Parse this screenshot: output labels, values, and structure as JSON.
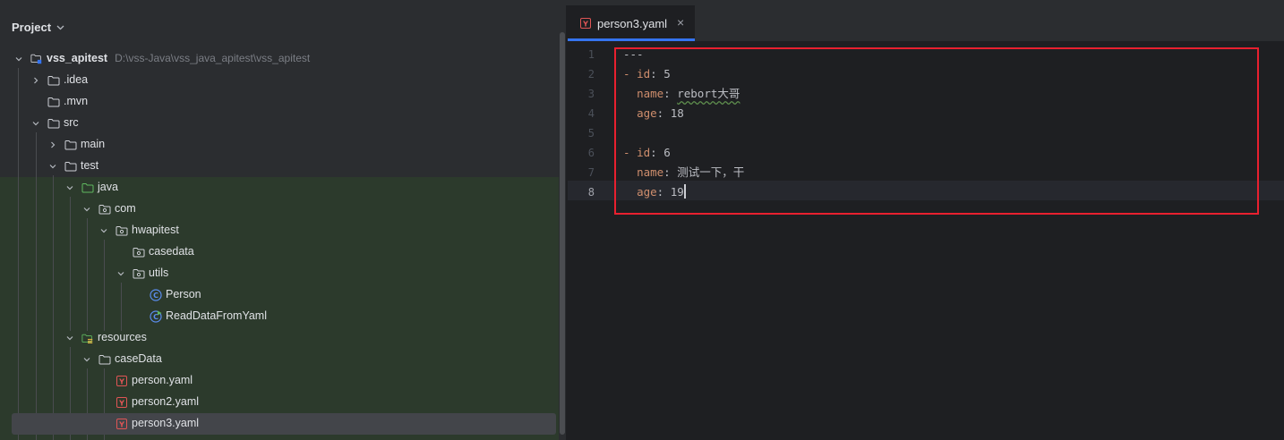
{
  "project": {
    "title": "Project",
    "tree": [
      {
        "label": "vss_apitest",
        "path": "D:\\vss-Java\\vss_java_apitest\\vss_apitest",
        "icon": "module-folder-icon",
        "expanded": true,
        "depth": 0
      },
      {
        "label": ".idea",
        "icon": "folder-icon",
        "expanded": false,
        "depth": 1
      },
      {
        "label": ".mvn",
        "icon": "folder-icon",
        "depth": 1
      },
      {
        "label": "src",
        "icon": "folder-icon",
        "expanded": true,
        "depth": 1
      },
      {
        "label": "main",
        "icon": "folder-icon",
        "expanded": false,
        "depth": 2
      },
      {
        "label": "test",
        "icon": "folder-icon",
        "expanded": true,
        "depth": 2
      },
      {
        "label": "java",
        "icon": "test-source-folder-icon",
        "expanded": true,
        "depth": 3
      },
      {
        "label": "com",
        "icon": "package-icon",
        "expanded": true,
        "depth": 4
      },
      {
        "label": "hwapitest",
        "icon": "package-icon",
        "expanded": true,
        "depth": 5
      },
      {
        "label": "casedata",
        "icon": "package-icon",
        "depth": 6
      },
      {
        "label": "utils",
        "icon": "package-icon",
        "expanded": true,
        "depth": 6
      },
      {
        "label": "Person",
        "icon": "java-class-icon",
        "depth": 7
      },
      {
        "label": "ReadDataFromYaml",
        "icon": "java-class-runnable-icon",
        "depth": 7
      },
      {
        "label": "resources",
        "icon": "test-resources-folder-icon",
        "expanded": true,
        "depth": 3
      },
      {
        "label": "caseData",
        "icon": "folder-icon",
        "expanded": true,
        "depth": 4
      },
      {
        "label": "person.yaml",
        "icon": "yaml-file-icon",
        "depth": 5
      },
      {
        "label": "person2.yaml",
        "icon": "yaml-file-icon",
        "depth": 5
      },
      {
        "label": "person3.yaml",
        "icon": "yaml-file-icon",
        "depth": 5,
        "selected": true
      }
    ]
  },
  "editor": {
    "tab": {
      "label": "person3.yaml",
      "close": "×"
    },
    "line_numbers": [
      "1",
      "2",
      "3",
      "4",
      "5",
      "6",
      "7",
      "8"
    ],
    "current_line": 8,
    "lines": [
      {
        "text": "---"
      },
      {
        "dash": "- ",
        "key": "id",
        "sep": ": ",
        "value": "5"
      },
      {
        "indent": "  ",
        "key": "name",
        "sep": ": ",
        "value": "rebort大哥"
      },
      {
        "indent": "  ",
        "key": "age",
        "sep": ": ",
        "value": "18"
      },
      {
        "text": ""
      },
      {
        "dash": "- ",
        "key": "id",
        "sep": ": ",
        "value": "6"
      },
      {
        "indent": "  ",
        "key": "name",
        "sep": ": ",
        "value": "测试一下，干"
      },
      {
        "indent": "  ",
        "key": "age",
        "sep": ": ",
        "value": "19"
      }
    ]
  },
  "colors": {
    "accent": "#3574f0",
    "highlight_box": "#e8202f",
    "yaml_key": "#cf8e6d"
  }
}
